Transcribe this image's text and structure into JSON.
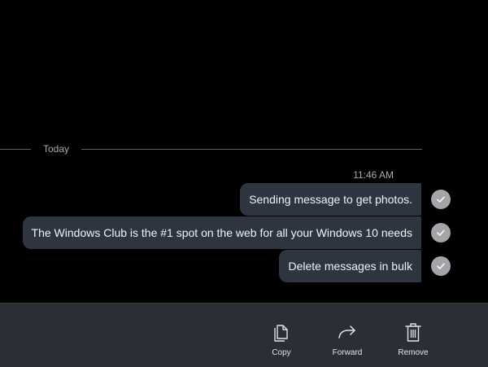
{
  "chat": {
    "divider_label": "Today",
    "timestamp": "11:46 AM",
    "messages": [
      {
        "text": "Sending message to get photos.",
        "status": "read-check-icon"
      },
      {
        "text": "The Windows Club is the #1 spot on the web for all your Windows 10 needs",
        "status": "read-check-icon"
      },
      {
        "text": "Delete messages in bulk",
        "status": "read-check-icon"
      }
    ]
  },
  "toolbar": {
    "copy_label": "Copy",
    "forward_label": "Forward",
    "remove_label": "Remove"
  },
  "colors": {
    "background": "#000000",
    "bubble": "#2f3540",
    "toolbar": "#2a2e35",
    "status_circle": "#a3a5a8"
  }
}
